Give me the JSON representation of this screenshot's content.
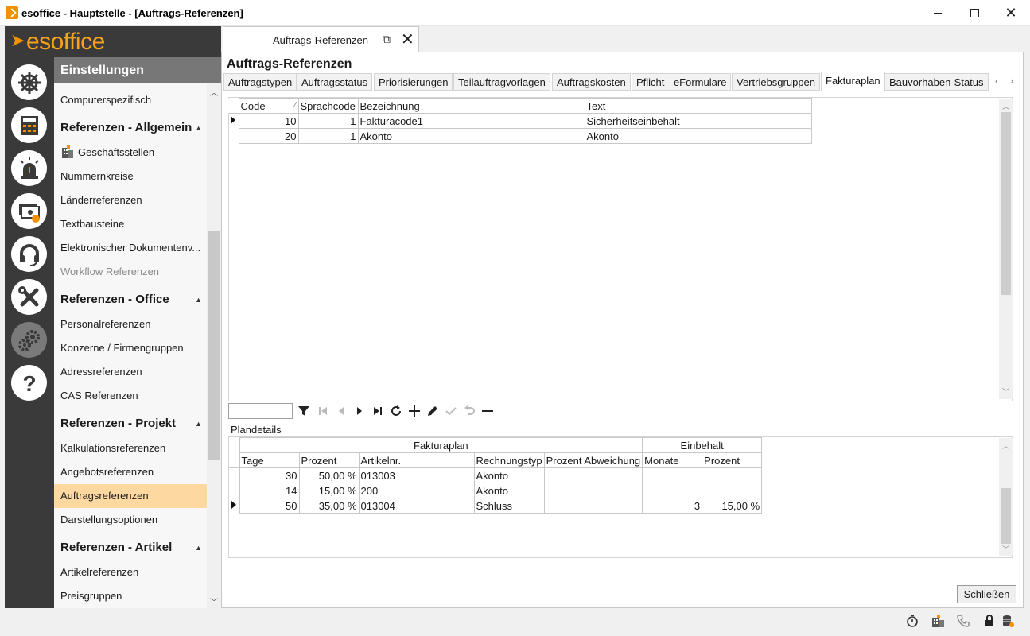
{
  "window": {
    "title": "esoffice - Hauptstelle - [Auftrags-Referenzen]"
  },
  "logo": {
    "text": "esoffice"
  },
  "rail": {
    "icons": [
      "helm-icon",
      "calculator-icon",
      "alarm-icon",
      "money-icon",
      "headset-icon",
      "tools-icon",
      "gears-icon",
      "help-icon"
    ],
    "active": "gears-icon"
  },
  "settings": {
    "header": "Einstellungen",
    "items": {
      "computerspezifisch": "Computerspezifisch",
      "sec_allgemein": "Referenzen - Allgemein",
      "geschaeftsstellen": "Geschäftsstellen",
      "nummernkreise": "Nummernkreise",
      "laender": "Länderreferenzen",
      "textbausteine": "Textbausteine",
      "elektronisch": "Elektronischer Dokumentenv...",
      "workflow": "Workflow Referenzen",
      "sec_office": "Referenzen - Office",
      "personal": "Personalreferenzen",
      "konzerne": "Konzerne / Firmengruppen",
      "adress": "Adressreferenzen",
      "cas": "CAS Referenzen",
      "sec_projekt": "Referenzen - Projekt",
      "kalkulation": "Kalkulationsreferenzen",
      "angebot": "Angebotsreferenzen",
      "auftrag": "Auftragsreferenzen",
      "darstellung": "Darstellungsoptionen",
      "sec_artikel": "Referenzen - Artikel",
      "artikel": "Artikelreferenzen",
      "preisgruppen": "Preisgruppen"
    }
  },
  "doc_tab": {
    "label": "Auftrags-Referenzen"
  },
  "page": {
    "title": "Auftrags-Referenzen"
  },
  "subtabs": [
    "Auftragstypen",
    "Auftragsstatus",
    "Priorisierungen",
    "Teilauftragvorlagen",
    "Auftragskosten",
    "Pflicht - eFormulare",
    "Vertriebsgruppen",
    "Fakturaplan",
    "Bauvorhaben-Status"
  ],
  "active_subtab": "Fakturaplan",
  "grid1": {
    "columns": [
      "Code",
      "Sprachcode",
      "Bezeichnung",
      "Text"
    ],
    "rows": [
      {
        "code": "10",
        "sprachcode": "1",
        "bezeichnung": "Fakturacode1",
        "text": "Sicherheitseinbehalt"
      },
      {
        "code": "20",
        "sprachcode": "1",
        "bezeichnung": "Akonto",
        "text": "Akonto"
      }
    ]
  },
  "plandetails": {
    "label": "Plandetails",
    "band_fakturaplan": "Fakturaplan",
    "band_einbehalt": "Einbehalt",
    "columns": [
      "Tage",
      "Prozent",
      "Artikelnr.",
      "Rechnungstyp",
      "Prozent Abweichung",
      "Monate",
      "Prozent"
    ],
    "rows": [
      {
        "tage": "30",
        "prozent": "50,00 %",
        "artikelnr": "013003",
        "rechnungstyp": "Akonto",
        "abweichung": "",
        "monate": "",
        "prozent2": ""
      },
      {
        "tage": "14",
        "prozent": "15,00 %",
        "artikelnr": "200",
        "rechnungstyp": "Akonto",
        "abweichung": "",
        "monate": "",
        "prozent2": ""
      },
      {
        "tage": "50",
        "prozent": "35,00 %",
        "artikelnr": "013004",
        "rechnungstyp": "Schluss",
        "abweichung": "",
        "monate": "3",
        "prozent2": "15,00 %"
      }
    ]
  },
  "buttons": {
    "close": "Schließen"
  }
}
